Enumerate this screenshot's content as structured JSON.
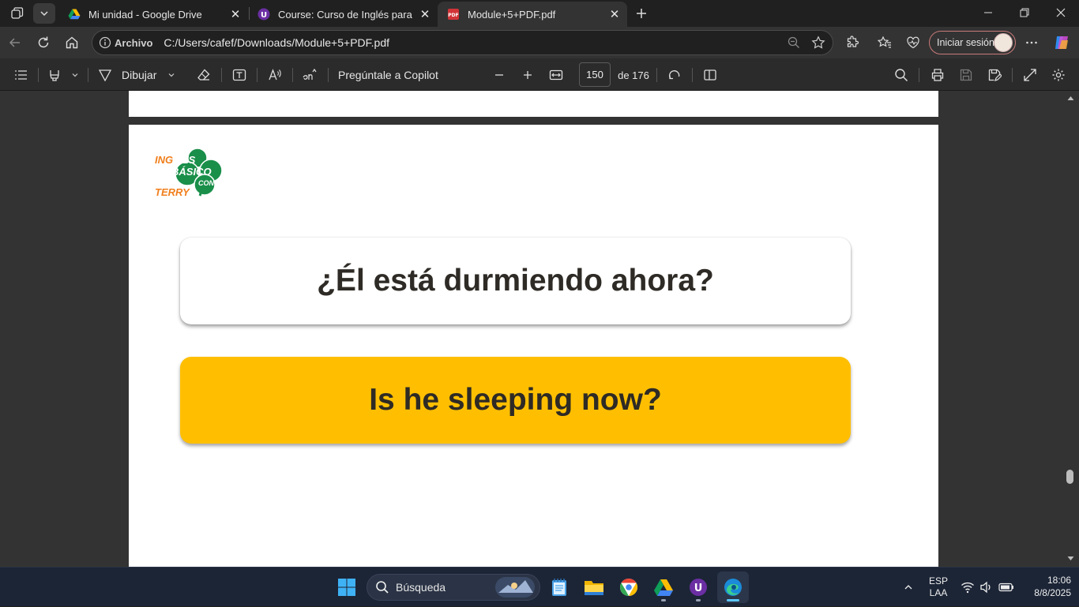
{
  "tabs": [
    {
      "title": "Mi unidad - Google Drive"
    },
    {
      "title": "Course: Curso de Inglés para principiantes"
    },
    {
      "title": "Module+5+PDF.pdf"
    }
  ],
  "address": {
    "site_label": "Archivo",
    "url": "C:/Users/cafef/Downloads/Module+5+PDF.pdf"
  },
  "profile": {
    "signin_label": "Iniciar sesión"
  },
  "pdf_toolbar": {
    "draw_label": "Dibujar",
    "copilot_label": "Pregúntale a Copilot",
    "page_number": "150",
    "page_total": "de 176"
  },
  "slide": {
    "logo_lines": [
      "INGLÉS",
      "BÁSICO",
      "CON",
      "TERRY"
    ],
    "question": "¿Él está durmiendo ahora?",
    "answer": "Is he sleeping now?"
  },
  "taskbar": {
    "search_placeholder": "Búsqueda",
    "lang_top": "ESP",
    "lang_bottom": "LAA",
    "time": "18:06",
    "date": "8/8/2025"
  },
  "colors": {
    "answer_card": "#ffbf00",
    "logo_orange": "#f07f1c",
    "logo_green": "#1a8f4a"
  }
}
